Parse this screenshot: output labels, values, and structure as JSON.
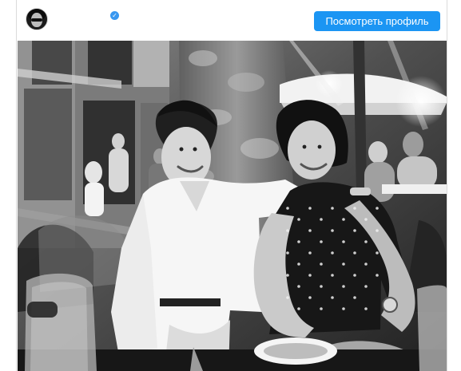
{
  "header": {
    "profile_button_label": "Посмотреть профиль"
  },
  "icons": {
    "avatar": "avatar",
    "verified": "verified-badge-icon"
  },
  "colors": {
    "button_blue": "#1b95f3",
    "verified_blue": "#3897f0",
    "border": "#dbdbdb"
  }
}
